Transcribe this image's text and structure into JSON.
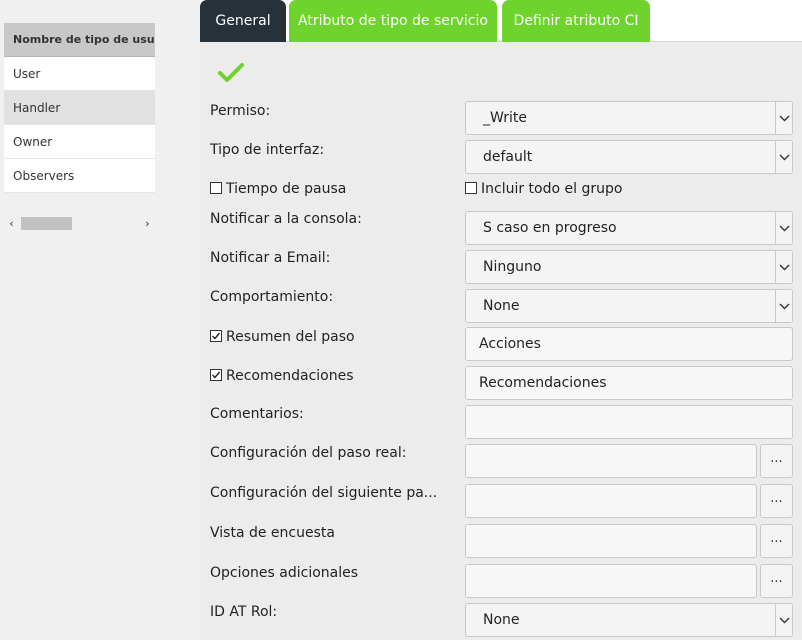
{
  "left_grid": {
    "header": "Nombre de tipo de usuario",
    "rows": [
      "User",
      "Handler",
      "Owner",
      "Observers"
    ]
  },
  "tabs": [
    "General",
    "Atributo de tipo de servicio",
    "Definir atributo CI"
  ],
  "form": {
    "permiso_label": "Permiso:",
    "permiso_value": "_Write",
    "tipo_interfaz_label": "Tipo de interfaz:",
    "tipo_interfaz_value": "default",
    "tiempo_pausa_label": "Tiempo de pausa",
    "incluir_grupo_label": "Incluir todo el grupo",
    "notificar_consola_label": "Notificar a la consola:",
    "notificar_consola_value": "S caso en progreso",
    "notificar_email_label": "Notificar a Email:",
    "notificar_email_value": "Ninguno",
    "comportamiento_label": "Comportamiento:",
    "comportamiento_value": "None",
    "resumen_paso_label": "Resumen del paso",
    "resumen_paso_value": "Acciones",
    "recomendaciones_label": "Recomendaciones",
    "recomendaciones_value": "Recomendaciones",
    "comentarios_label": "Comentarios:",
    "config_paso_real_label": "Configuración del paso real:",
    "config_siguiente_label": "Configuración del siguiente pa...",
    "vista_encuesta_label": "Vista de encuesta",
    "opciones_adicionales_label": "Opciones adicionales",
    "id_at_rol_label": "ID AT Rol:",
    "id_at_rol_value": "None",
    "ellipsis": "..."
  },
  "colors": {
    "tab_active": "#27313a",
    "tab_inactive": "#6ed32c",
    "check": "#6ed32c"
  }
}
